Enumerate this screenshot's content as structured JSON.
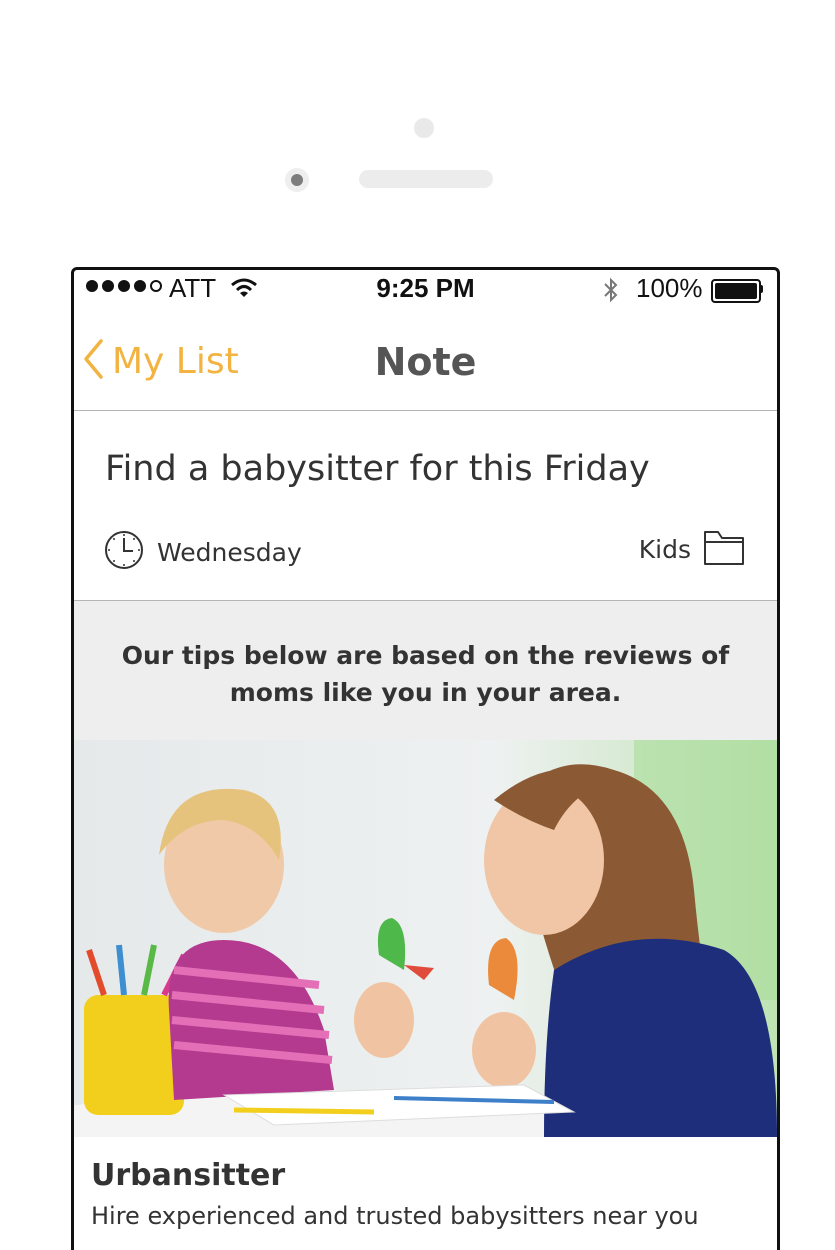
{
  "status_bar": {
    "carrier": "ATT",
    "time": "9:25 PM",
    "battery": "100%"
  },
  "nav": {
    "back_label": "My List",
    "title": "Note"
  },
  "note": {
    "title": "Find a babysitter for this Friday",
    "due": "Wednesday",
    "category": "Kids"
  },
  "tips": {
    "text": "Our tips below are based on the reviews of moms like you in your area."
  },
  "card": {
    "title": "Urbansitter",
    "subtitle": "Hire experienced and trusted babysitters near you"
  },
  "colors": {
    "accent": "#f2b341",
    "divider": "#b5b5b5",
    "tips_bg": "#eeeeee"
  }
}
